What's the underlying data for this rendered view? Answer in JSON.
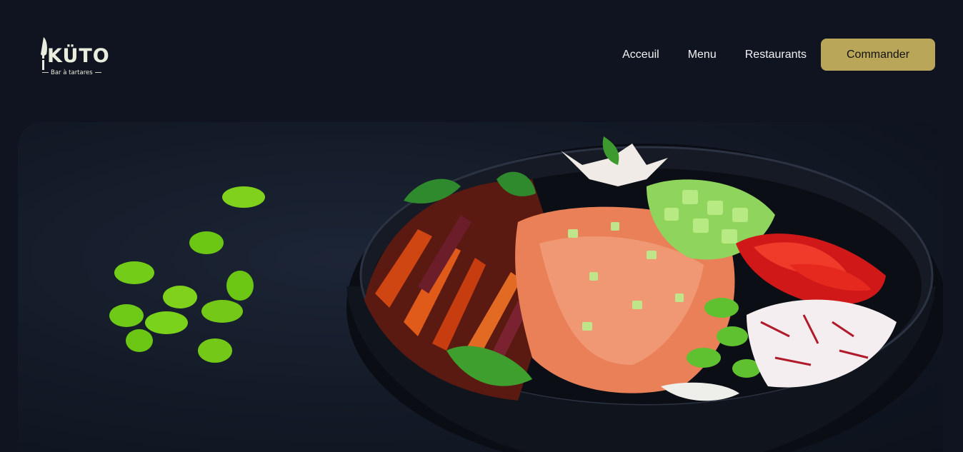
{
  "brand": {
    "name": "KÜTO",
    "tagline": "Bar à tartares"
  },
  "nav": {
    "links": [
      {
        "label": "Acceuil"
      },
      {
        "label": "Menu"
      },
      {
        "label": "Restaurants"
      }
    ],
    "cta_label": "Commander"
  },
  "colors": {
    "background": "#0f1420",
    "accent": "#b9a659",
    "logo": "#e9eddc"
  },
  "hero": {
    "image": "poke-bowl-photo"
  }
}
